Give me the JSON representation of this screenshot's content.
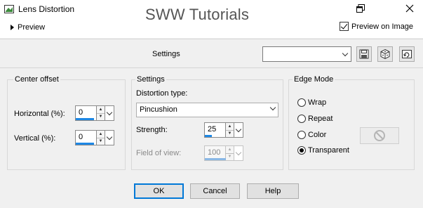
{
  "window": {
    "title": "Lens Distortion",
    "watermark": "SWW Tutorials"
  },
  "preview": {
    "toggle_label": "Preview",
    "preview_on_image_label": "Preview on Image",
    "preview_on_image_checked": true
  },
  "presets": {
    "label": "Settings",
    "value": ""
  },
  "center_offset": {
    "title": "Center offset",
    "horizontal_label": "Horizontal (%):",
    "horizontal_value": "0",
    "vertical_label": "Vertical (%):",
    "vertical_value": "0"
  },
  "settings": {
    "title": "Settings",
    "distortion_type_label": "Distortion type:",
    "distortion_type_value": "Pincushion",
    "strength_label": "Strength:",
    "strength_value": "25",
    "field_of_view_label": "Field of view:",
    "field_of_view_value": "100"
  },
  "edge_mode": {
    "title": "Edge Mode",
    "options": [
      "Wrap",
      "Repeat",
      "Color",
      "Transparent"
    ],
    "selected": "Transparent"
  },
  "buttons": {
    "ok": "OK",
    "cancel": "Cancel",
    "help": "Help"
  },
  "colors": {
    "accent": "#1e88e5",
    "default_button_border": "#0078d7"
  },
  "icons": [
    "app-icon",
    "restore-icon",
    "close-icon",
    "save-preset-icon",
    "randomize-icon",
    "reset-icon",
    "no-color-icon"
  ]
}
